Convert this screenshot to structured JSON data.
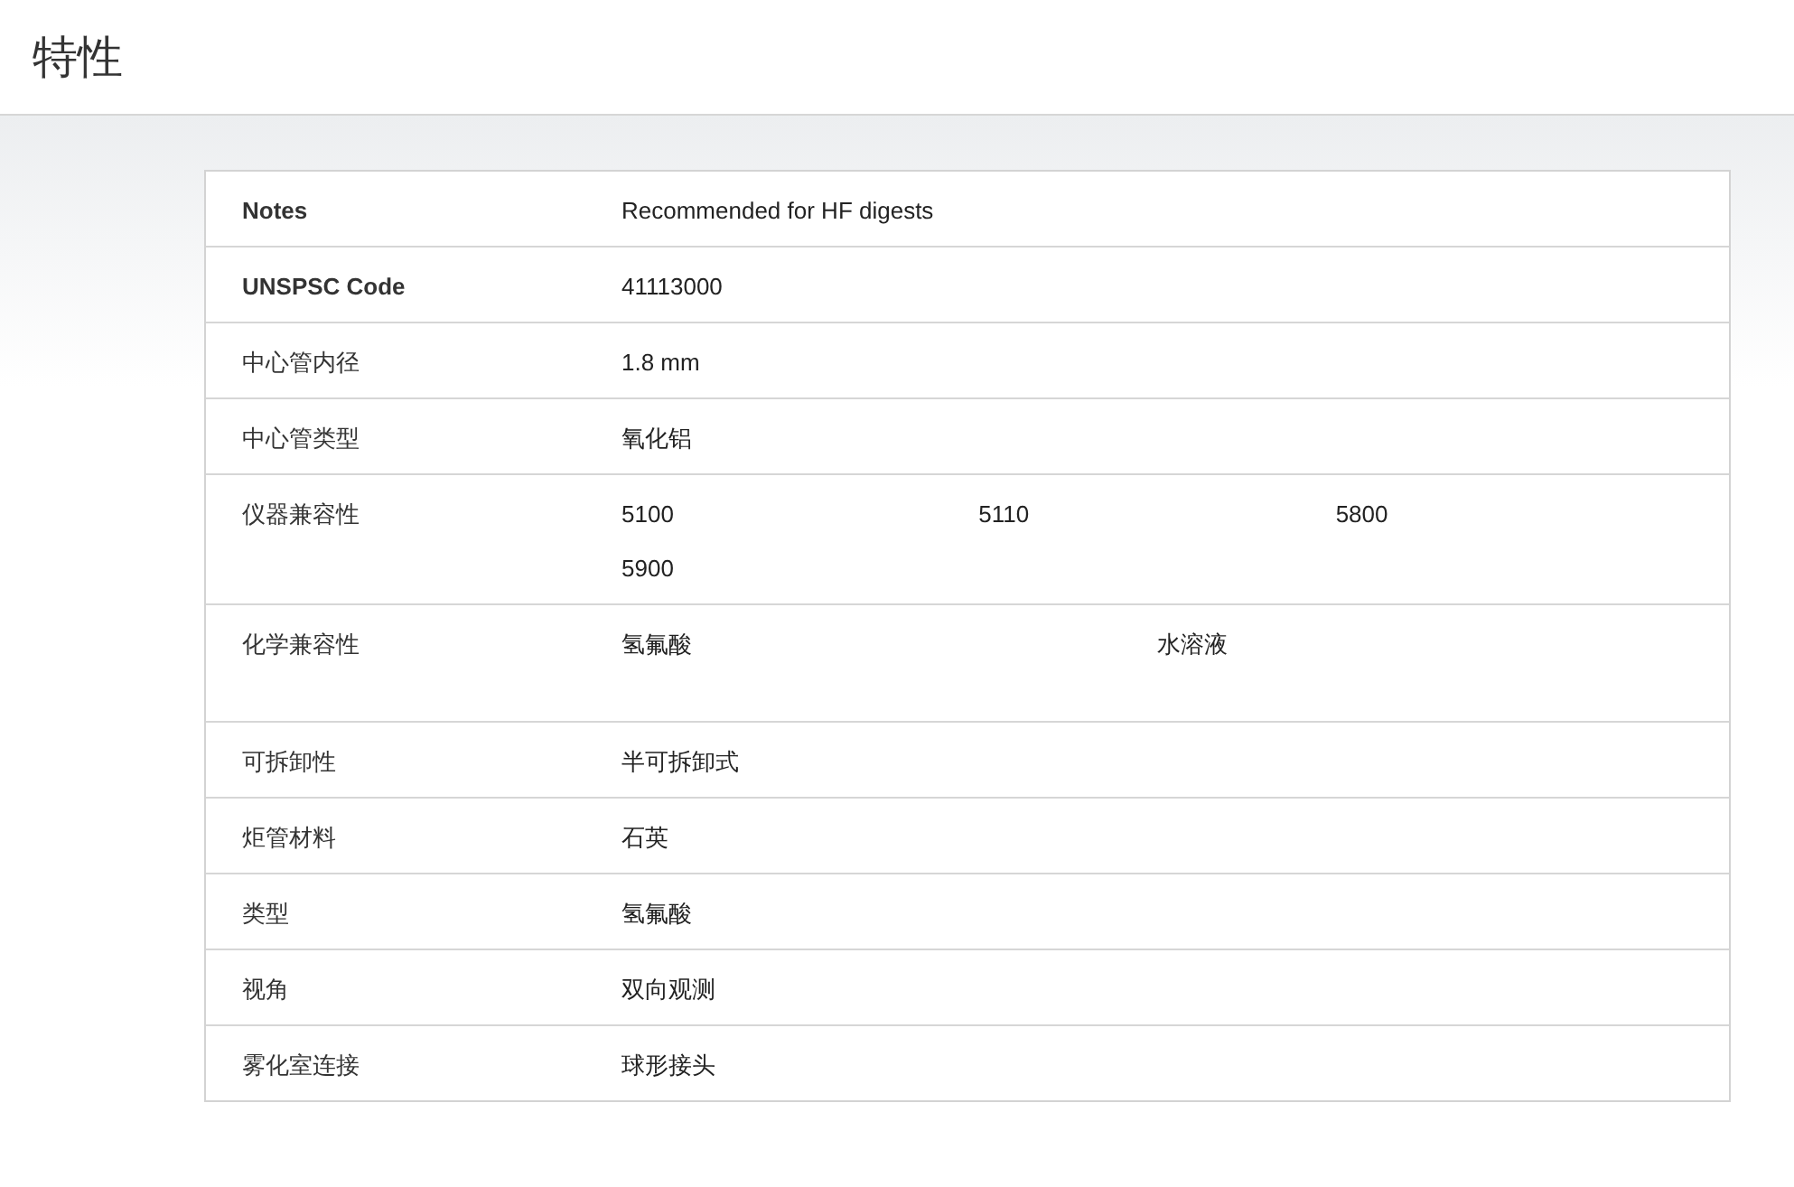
{
  "header": {
    "title": "特性"
  },
  "rows": [
    {
      "label": "Notes",
      "bold": true,
      "values": [
        "Recommended for HF digests"
      ]
    },
    {
      "label": "UNSPSC Code",
      "bold": true,
      "values": [
        "41113000"
      ]
    },
    {
      "label": "中心管内径",
      "bold": false,
      "values": [
        "1.8 mm"
      ]
    },
    {
      "label": "中心管类型",
      "bold": false,
      "values": [
        "氧化铝"
      ]
    },
    {
      "label": "仪器兼容性",
      "bold": false,
      "values": [
        "5100",
        "5110",
        "5800",
        "5900"
      ]
    },
    {
      "label": "化学兼容性",
      "bold": false,
      "values": [
        "氢氟酸",
        "水溶液"
      ]
    },
    {
      "label": "可拆卸性",
      "bold": false,
      "values": [
        "半可拆卸式"
      ]
    },
    {
      "label": "炬管材料",
      "bold": false,
      "values": [
        "石英"
      ]
    },
    {
      "label": "类型",
      "bold": false,
      "values": [
        "氢氟酸"
      ]
    },
    {
      "label": "视角",
      "bold": false,
      "values": [
        "双向观测"
      ]
    },
    {
      "label": "雾化室连接",
      "bold": false,
      "values": [
        "球形接头"
      ]
    }
  ]
}
